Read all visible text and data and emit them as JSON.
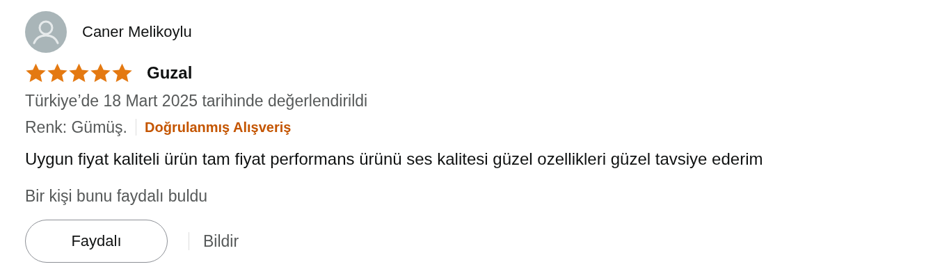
{
  "review": {
    "author": "Caner Melikoylu",
    "stars": 5,
    "title": "Guzal",
    "date": "Türkiye’de 18 Mart 2025 tarihinde değerlendirildi",
    "variant": "Renk: Gümüş.",
    "verified": "Doğrulanmış Alışveriş",
    "body": "Uygun fiyat kaliteli ürün tam fiyat performans ürünü ses kalitesi güzel ozellikleri güzel tavsiye ederim",
    "helpful_count": "Bir kişi bunu faydalı buldu",
    "buttons": [
      "Faydalı"
    ],
    "report": "Bildir"
  }
}
